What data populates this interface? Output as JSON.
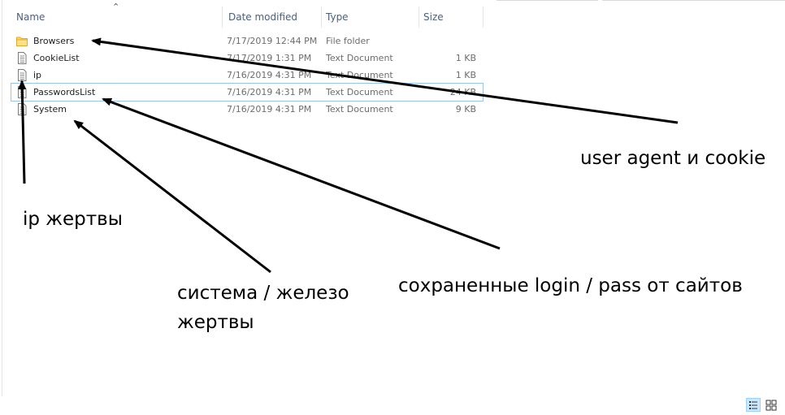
{
  "columns": {
    "name": "Name",
    "date_modified": "Date modified",
    "type": "Type",
    "size": "Size"
  },
  "files": [
    {
      "name": "Browsers",
      "date": "7/17/2019 12:44 PM",
      "type": "File folder",
      "size": "",
      "icon": "folder-icon"
    },
    {
      "name": "CookieList",
      "date": "7/17/2019 1:31 PM",
      "type": "Text Document",
      "size": "1 KB",
      "icon": "text-file-icon"
    },
    {
      "name": "ip",
      "date": "7/16/2019 4:31 PM",
      "type": "Text Document",
      "size": "1 KB",
      "icon": "text-file-icon"
    },
    {
      "name": "PasswordsList",
      "date": "7/16/2019 4:31 PM",
      "type": "Text Document",
      "size": "24 KB",
      "icon": "text-file-icon",
      "selected": true
    },
    {
      "name": "System",
      "date": "7/16/2019 4:31 PM",
      "type": "Text Document",
      "size": "9 KB",
      "icon": "text-file-icon"
    }
  ],
  "annotations": {
    "user_agent_cookie": "user agent и cookie",
    "victim_ip": "ip жертвы",
    "system_line1": "система / железо",
    "system_line2": "жертвы",
    "saved_passwords": "сохраненные login / pass от сайтов"
  },
  "colors": {
    "header_text": "#4c607a",
    "selection_border": "#99c4ec",
    "folder": "#ffd866",
    "arrow": "#000000"
  }
}
